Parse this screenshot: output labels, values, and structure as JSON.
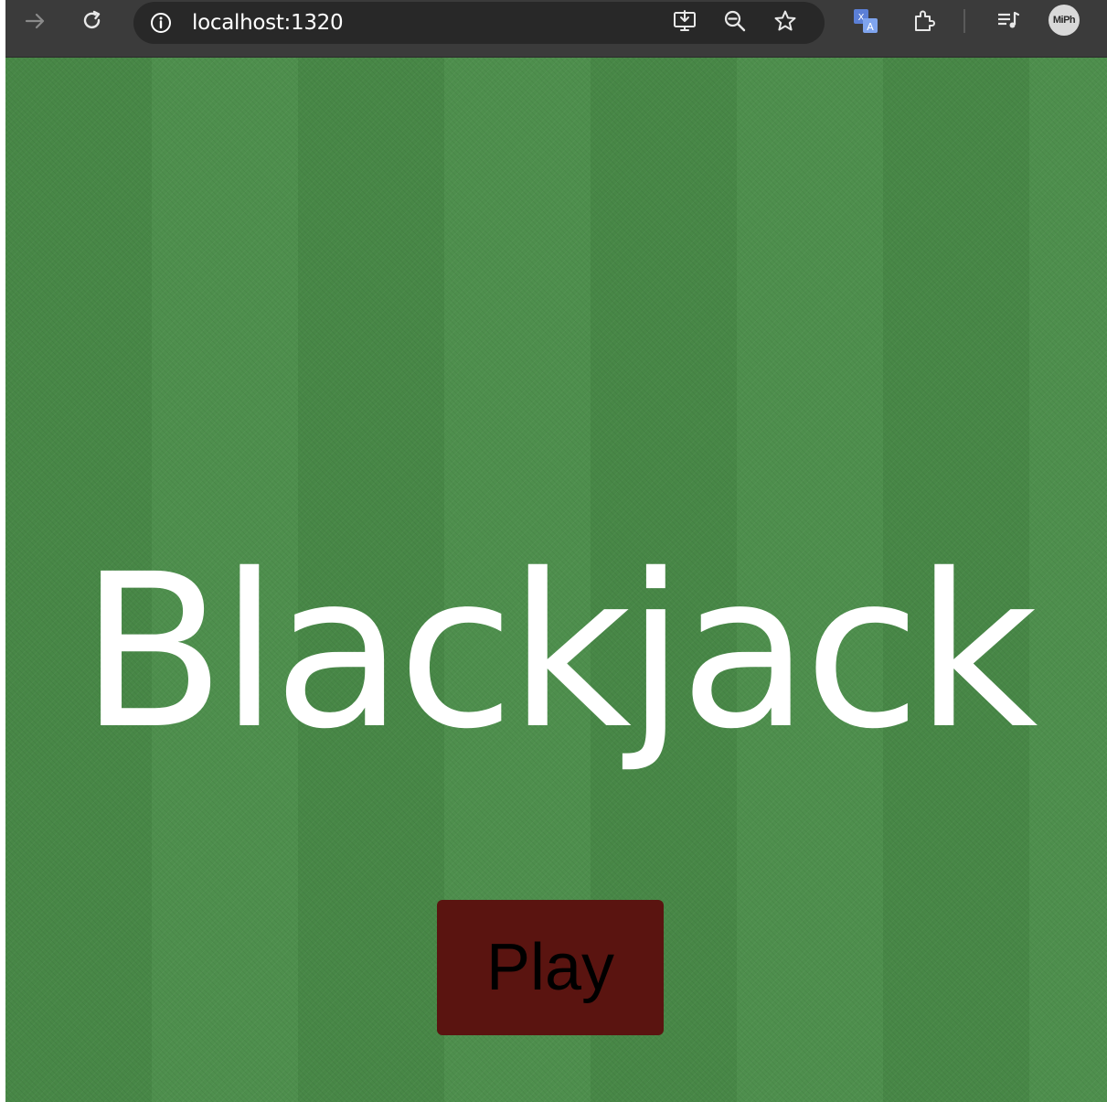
{
  "browser": {
    "url": "localhost:1320",
    "profile_label": "MiPh",
    "icons": {
      "forward": "forward-arrow-icon",
      "reload": "reload-icon",
      "site_info": "info-icon",
      "install": "install-app-icon",
      "zoom": "zoom-out-icon",
      "bookmark": "star-icon",
      "translate": "translate-icon",
      "extensions": "puzzle-icon",
      "media": "media-queue-icon"
    }
  },
  "page": {
    "title": "Blackjack",
    "play_label": "Play",
    "colors": {
      "felt": "#4a8c49",
      "title_text": "#ffffff",
      "button_bg": "#5a1410",
      "button_text": "#000000"
    }
  }
}
